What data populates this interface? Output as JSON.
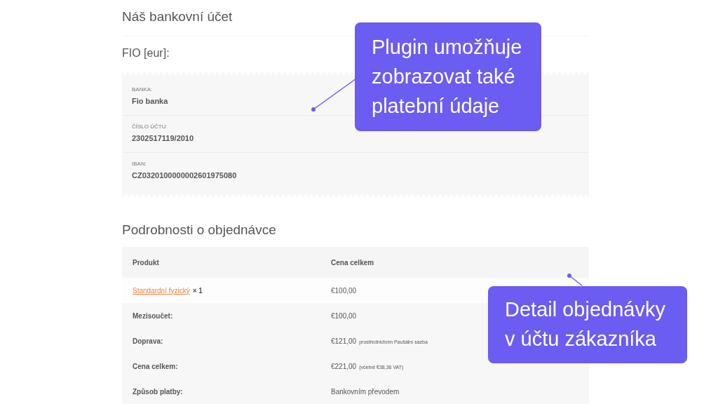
{
  "bank_account": {
    "title": "Náš bankovní účet",
    "account_name": "FIO [eur]:",
    "fields": [
      {
        "label": "BANKA:",
        "value": "Fio banka"
      },
      {
        "label": "ČÍSLO ÚČTU:",
        "value": "2302517119/2010"
      },
      {
        "label": "IBAN:",
        "value": "CZ0320100000002601975080"
      }
    ]
  },
  "order_details": {
    "title": "Podrobnosti o objednávce",
    "columns": [
      "Produkt",
      "Cena celkem"
    ],
    "rows": [
      {
        "kind": "product",
        "product": "Standardní fyzický",
        "quantity": "× 1",
        "value": "€100,00"
      },
      {
        "kind": "total",
        "label": "Mezisoučet:",
        "value": "€100,00"
      },
      {
        "kind": "total",
        "label": "Doprava:",
        "value": "€121,00",
        "note": "prostřednictvím Paušální sazba"
      },
      {
        "kind": "total",
        "label": "Cena celkem:",
        "value": "€221,00",
        "note": "(včetně €38,36 VAT)"
      },
      {
        "kind": "total",
        "label": "Způsob platby:",
        "value": "Bankovním převodem"
      }
    ]
  },
  "callouts": [
    {
      "text": "Plugin umožňuje zobrazovat také platební údaje"
    },
    {
      "text": "Detail objednávky v účtu zákazníka"
    }
  ]
}
